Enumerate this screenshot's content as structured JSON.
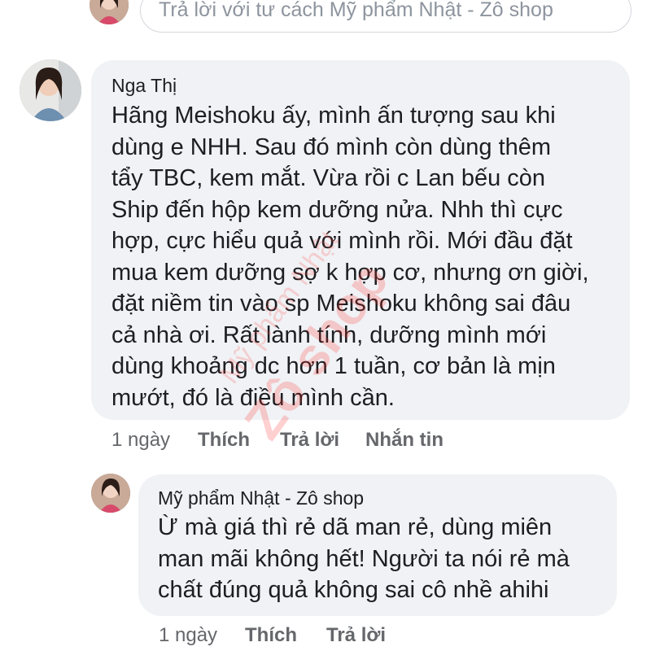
{
  "reply_box": {
    "placeholder": "Trả lời với tư cách Mỹ phẩm Nhật - Zô shop"
  },
  "comments": [
    {
      "author": "Nga Thị",
      "lines": [
        "Hãng Meishoku ấy, mình ấn tượng sau khi",
        "dùng e NHH. Sau đó mình còn dùng thêm",
        "tẩy TBC, kem mắt. Vừa rồi c Lan bếu còn",
        "Ship đến hộp kem dưỡng nửa. Nhh thì cực",
        "hợp, cực hiểu quả với mình rồi. Mới đầu đặt",
        "mua kem dưỡng sợ k hợp cơ, nhưng ơn giời,",
        "đặt niềm tin vào sp Meishoku không sai đâu",
        "cả nhà ơi. Rất lành tính, dưỡng mình mới",
        "dùng khoảng dc hơn 1 tuần, cơ bản là mịn",
        "mướt, đó là điều mình cần."
      ],
      "time": "1 ngày",
      "like": "Thích",
      "reply": "Trả lời",
      "message": "Nhắn tin"
    },
    {
      "author": "Mỹ phẩm Nhật - Zô shop",
      "lines": [
        "Ừ mà giá thì rẻ dã man rẻ, dùng miên",
        "man mãi không hết! Người ta nói rẻ mà",
        "chất đúng quả không sai cô nhề ahihi"
      ],
      "time": "1 ngày",
      "like": "Thích",
      "reply": "Trả lời"
    }
  ],
  "watermark": {
    "line1": "Mỹ phẩm Nhật",
    "line2": "Zô shop"
  },
  "colors": {
    "bubble": "#f0f2f5",
    "text": "#1c1e21",
    "muted": "#65676b",
    "watermark": "#ff2e2e"
  }
}
